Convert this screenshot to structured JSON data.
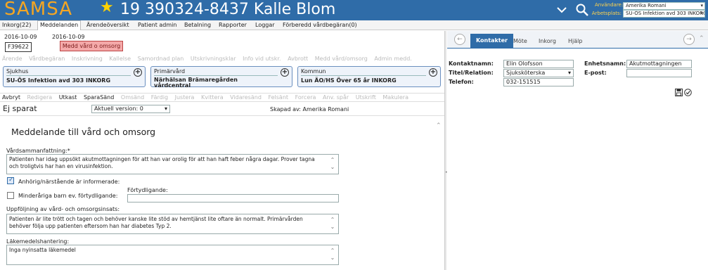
{
  "header": {
    "logo": "SAMSA",
    "patient": "19 390324-8437 Kalle Blom",
    "user_label": "Användare:",
    "user_value": "Amerika Romani",
    "workplace_label": "Arbetsplats:",
    "workplace_value": "SU-ÖS Infektion avd 303 INKORG"
  },
  "topnav": [
    "Inkorg(22)",
    "Meddelanden",
    "Ärendeöversikt",
    "Patient admin",
    "Betalning",
    "Rapporter",
    "Loggar",
    "Förberedd vårdbegäran(0)"
  ],
  "message": {
    "date1": "2016-10-09",
    "date2": "2016-10-09",
    "id": "F39622",
    "type_label": "Medd vård o omsorg"
  },
  "toolbar1": [
    "Ärende",
    "Vårdbegäran",
    "Inskrivning",
    "Kallelse",
    "Samordnad plan",
    "Utskrivningsklar",
    "Info vid utskr.",
    "Avbrott",
    "Medd vård/omsorg",
    "Admin medd."
  ],
  "cards": [
    {
      "title": "Sjukhus",
      "value": "SU-ÖS Infektion avd 303 INKORG"
    },
    {
      "title": "Primärvård",
      "value": "Närhälsan Brämaregården vårdcentral"
    },
    {
      "title": "Kommun",
      "value": "Lun ÄO/HS Över 65 år INKORG"
    }
  ],
  "toolbar2": [
    {
      "label": "Avbryt",
      "enabled": true
    },
    {
      "label": "Redigera",
      "enabled": false
    },
    {
      "label": "Utkast",
      "enabled": true
    },
    {
      "label": "SparaSänd",
      "enabled": true
    },
    {
      "label": "Omsänd",
      "enabled": false
    },
    {
      "label": "Färdig",
      "enabled": false
    },
    {
      "label": "Justera",
      "enabled": false
    },
    {
      "label": "Kvittera",
      "enabled": false
    },
    {
      "label": "Vidaresänd",
      "enabled": false
    },
    {
      "label": "Felsänt",
      "enabled": false
    },
    {
      "label": "Forcera",
      "enabled": false
    },
    {
      "label": "Anv. spår",
      "enabled": false
    },
    {
      "label": "Utskrift",
      "enabled": false
    },
    {
      "label": "Makulera",
      "enabled": false
    }
  ],
  "status": {
    "unsaved": "Ej sparat",
    "version": "Aktuell version: 0",
    "created": "Skapad av: Amerika Romani"
  },
  "form": {
    "heading": "Meddelande till vård och omsorg",
    "summary_label": "Vårdsammanfattning:*",
    "summary_text": "Patienten har idag uppsökt akutmottagningen för att han var orolig för att han haft feber några dagar. Prover tagna och troligtvis har han en virusinfektion.",
    "relative_informed_label": "Anhörig/närstående är informerade:",
    "relative_informed": true,
    "minor_children_label": "Minderåriga barn ev. förtydligande:",
    "minor_children": false,
    "clarification_label": "Förtydligande:",
    "clarification_value": "",
    "followup_label": "Uppföljning av vård- och omsorgsinsats:",
    "followup_text": "Patienten är lite trött och tagen och behöver kanske lite stöd av hemtjänst lite oftare än normalt. Primärvården behöver följa upp patienten eftersom han har diabetes Typ 2.",
    "medication_label": "Läkemedelshantering:",
    "medication_text": "Inga nyinsatta läkemedel"
  },
  "right": {
    "tabs": [
      "Kontakter",
      "Möte",
      "Inkorg",
      "Hjälp"
    ],
    "contact_name_label": "Kontaktnamn:",
    "contact_name": "Elin Olofsson",
    "unit_name_label": "Enhetsnamn:",
    "unit_name": "Akutmottagningen",
    "title_label": "Titel/Relation:",
    "title_value": "Sjuksköterska",
    "email_label": "E-post:",
    "email_value": "",
    "phone_label": "Telefon:",
    "phone_value": "032-151515"
  }
}
